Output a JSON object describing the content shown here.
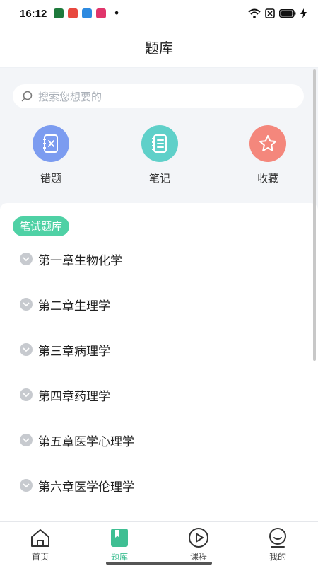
{
  "status_bar": {
    "time": "16:12",
    "app_icons": [
      {
        "name": "app-green-icon",
        "color": "#1e7a3c"
      },
      {
        "name": "app-music-icon",
        "color": "#e8483e"
      },
      {
        "name": "app-blue-icon",
        "color": "#2d8ae0"
      },
      {
        "name": "app-video-icon",
        "color": "#e0356b"
      }
    ],
    "more_indicator": "•",
    "icons": [
      "wifi-icon",
      "sim-off-icon",
      "battery-icon",
      "charging-icon"
    ]
  },
  "header": {
    "title": "题库"
  },
  "search": {
    "placeholder": "搜索您想要的"
  },
  "shortcuts": [
    {
      "label": "错题",
      "icon": "wrong-questions-icon",
      "color": "#7c9cf0"
    },
    {
      "label": "笔记",
      "icon": "notebook-icon",
      "color": "#5fd0c9"
    },
    {
      "label": "收藏",
      "icon": "star-icon",
      "color": "#f4877c"
    }
  ],
  "section": {
    "title": "笔试题库"
  },
  "chapters": [
    "第一章生物化学",
    "第二章生理学",
    "第三章病理学",
    "第四章药理学",
    "第五章医学心理学",
    "第六章医学伦理学"
  ],
  "tabbar": {
    "active": "题库",
    "tabs": [
      {
        "label": "首页",
        "icon": "home-icon"
      },
      {
        "label": "题库",
        "icon": "question-bank-icon"
      },
      {
        "label": "课程",
        "icon": "play-circle-icon"
      },
      {
        "label": "我的",
        "icon": "profile-icon"
      }
    ]
  },
  "colors": {
    "accent": "#4fd1a5",
    "tab_active": "#3fbf93",
    "background": "#f3f5f8"
  }
}
